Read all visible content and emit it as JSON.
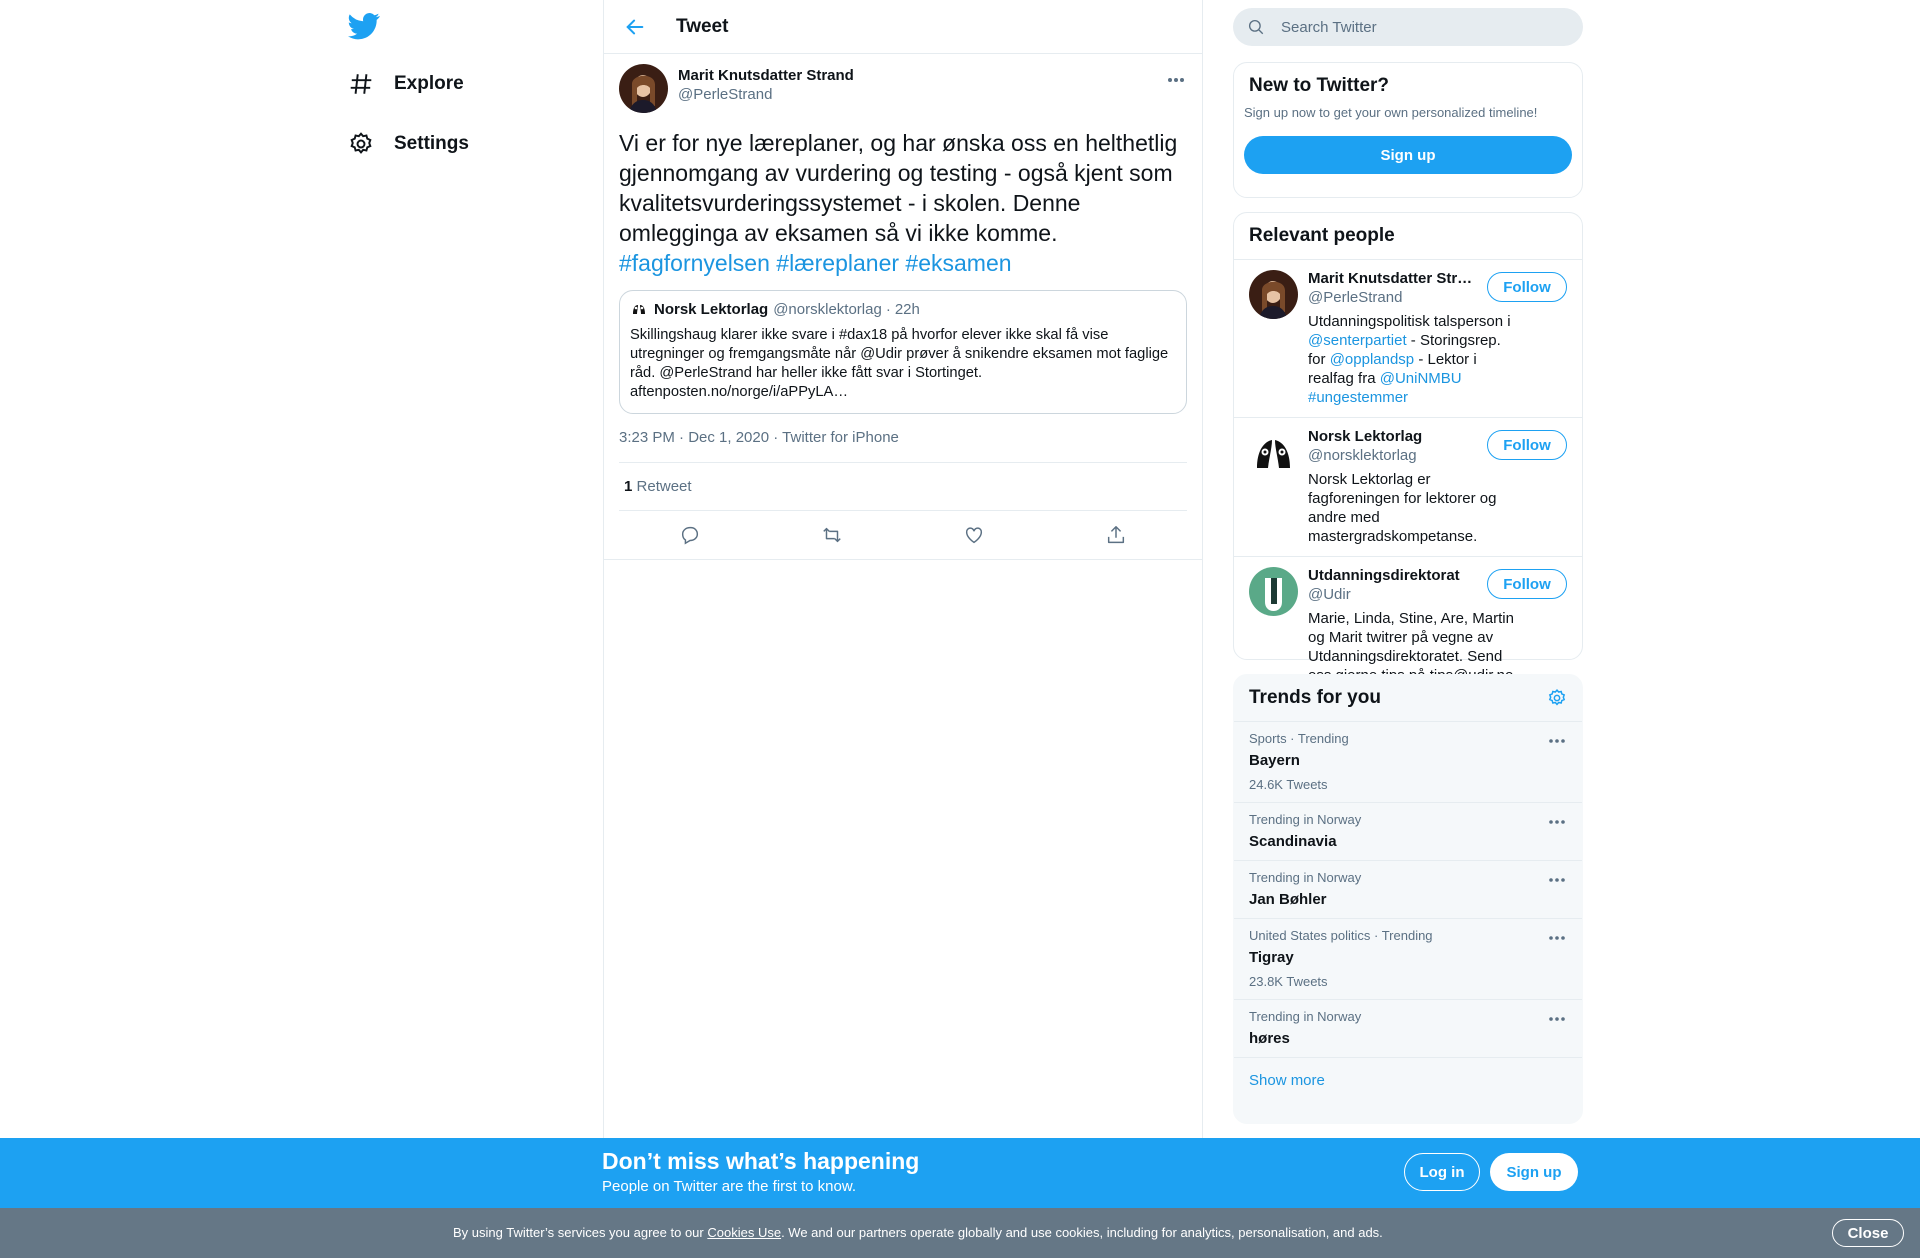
{
  "nav": {
    "items": [
      {
        "label": "Explore",
        "icon": "hashtag-icon"
      },
      {
        "label": "Settings",
        "icon": "gear-icon"
      }
    ]
  },
  "header": {
    "title": "Tweet"
  },
  "tweet": {
    "author_name": "Marit Knutsdatter Strand",
    "author_handle": "@PerleStrand",
    "text_plain": "Vi er for nye læreplaner, og har ønska oss en helthetlig gjennomgang av vurdering og testing - også kjent som kvalitetsvurderingssystemet - i skolen. Denne omlegginga av eksamen så vi ikke komme.",
    "hashtags": [
      "#fagfornyelsen",
      "#læreplaner",
      "#eksamen"
    ],
    "quote": {
      "name": "Norsk Lektorlag",
      "handle": "@norsklektorlag",
      "time": "22h",
      "text": "Skillingshaug klarer ikke svare i #dax18 på hvorfor elever ikke skal få vise utregninger og fremgangsmåte når @Udir prøver å snikendre eksamen mot faglige råd. @PerleStrand har heller ikke fått svar i Stortinget. aftenposten.no/norge/i/aPPyLA…"
    },
    "time": "3:23 PM · Dec 1, 2020",
    "source": "Twitter for iPhone",
    "retweet_count": "1",
    "retweet_label": "Retweet"
  },
  "search": {
    "placeholder": "Search Twitter"
  },
  "new_to_twitter": {
    "title": "New to Twitter?",
    "subtitle": "Sign up now to get your own personalized timeline!",
    "signup_label": "Sign up"
  },
  "relevant": {
    "title": "Relevant people",
    "follow_label": "Follow",
    "people": [
      {
        "name": "Marit Knutsdatter Str…",
        "handle": "@PerleStrand",
        "bio": [
          {
            "t": "Utdanningspolitisk talsperson i ",
            "link": false
          },
          {
            "t": "@senterpartiet",
            "link": true
          },
          {
            "t": " - Storingsrep. for ",
            "link": false
          },
          {
            "t": "@opplandsp",
            "link": true
          },
          {
            "t": " - Lektor i realfag fra ",
            "link": false
          },
          {
            "t": "@UniNMBU",
            "link": true
          },
          {
            "t": " ",
            "link": false
          },
          {
            "t": "#ungestemmer",
            "link": true
          }
        ]
      },
      {
        "name": "Norsk Lektorlag",
        "handle": "@norsklektorlag",
        "bio": [
          {
            "t": "Norsk Lektorlag er fagforeningen for lektorer og andre med mastergradskompetanse.",
            "link": false
          }
        ]
      },
      {
        "name": "Utdanningsdirektorat",
        "handle": "@Udir",
        "bio": [
          {
            "t": "Marie, Linda, Stine, Are, Martin og Marit twitrer på vegne av Utdanningsdirektoratet. Send oss gjerne tips på tips@udir.no :)",
            "link": false
          }
        ]
      }
    ]
  },
  "trends": {
    "title": "Trends for you",
    "items": [
      {
        "category": "Sports · Trending",
        "name": "Bayern",
        "count": "24.6K Tweets"
      },
      {
        "category": "Trending in Norway",
        "name": "Scandinavia",
        "count": ""
      },
      {
        "category": "Trending in Norway",
        "name": "Jan Bøhler",
        "count": ""
      },
      {
        "category": "United States politics · Trending",
        "name": "Tigray",
        "count": "23.8K Tweets"
      },
      {
        "category": "Trending in Norway",
        "name": "høres",
        "count": ""
      }
    ],
    "show_more": "Show more"
  },
  "banner": {
    "title": "Don’t miss what’s happening",
    "subtitle": "People on Twitter are the first to know.",
    "login_label": "Log in",
    "signup_label": "Sign up"
  },
  "cookie": {
    "prefix": "By using Twitter’s services you agree to our ",
    "link": "Cookies Use",
    "suffix": ". We and our partners operate globally and use cookies, including for analytics, personalisation, and ads.",
    "close_label": "Close"
  },
  "colors": {
    "accent": "#1da1f2",
    "link": "#1b95e0",
    "muted": "#5b7083",
    "cookie_bg": "#657786"
  }
}
